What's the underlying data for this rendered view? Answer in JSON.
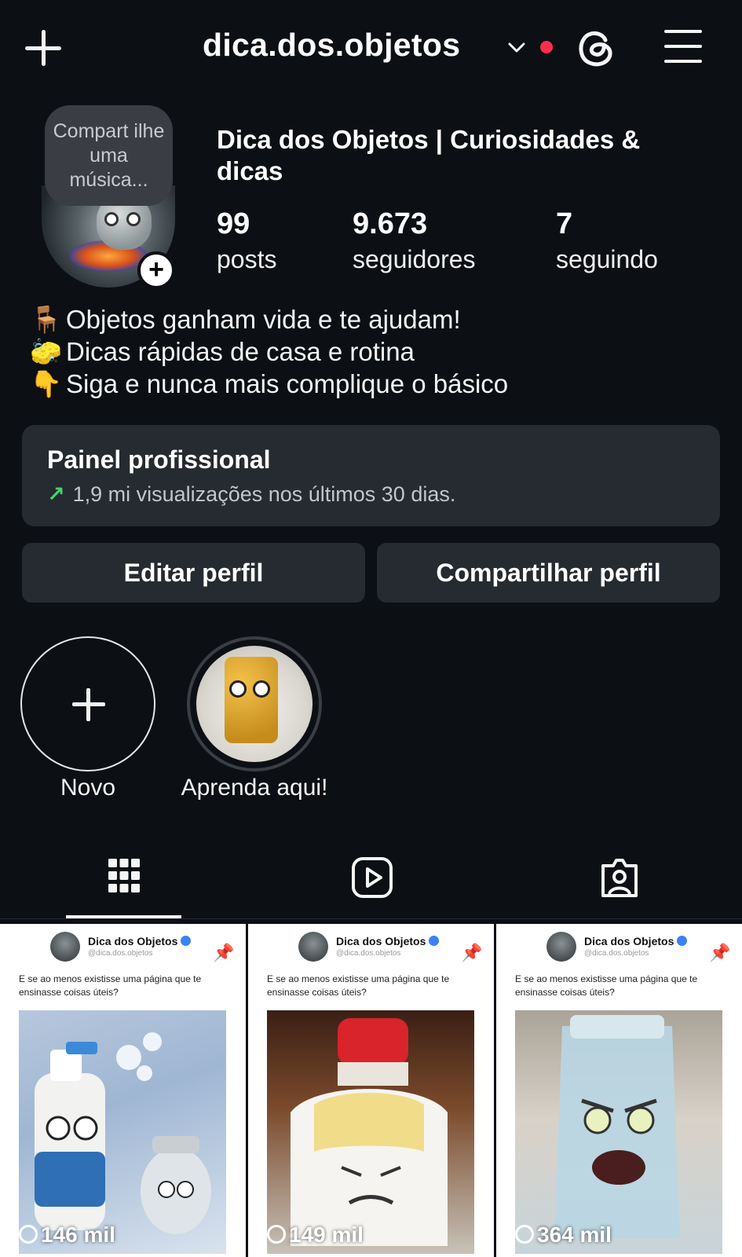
{
  "header": {
    "username": "dica.dos.objetos"
  },
  "profile": {
    "note": "Compart ilhe uma música...",
    "display_name": "Dica dos Objetos | Curiosidades & dicas",
    "stats": [
      {
        "value": "99",
        "label": "posts"
      },
      {
        "value": "9.673",
        "label": "seguidores"
      },
      {
        "value": "7",
        "label": "seguindo"
      }
    ],
    "bio": [
      {
        "emoji": "🪑",
        "text": "Objetos ganham vida e te ajudam!"
      },
      {
        "emoji": "🧽",
        "text": "Dicas rápidas de casa e rotina"
      },
      {
        "emoji": "👇",
        "text": "Siga e nunca mais complique o básico"
      }
    ]
  },
  "dashboard": {
    "title": "Painel profissional",
    "subtitle": "1,9 mi visualizações nos últimos 30 dias."
  },
  "actions": {
    "edit": "Editar perfil",
    "share": "Compartilhar perfil"
  },
  "highlights": [
    {
      "label": "Novo"
    },
    {
      "label": "Aprenda aqui!"
    }
  ],
  "tabs": [
    "grid-icon",
    "reels-icon",
    "tagged-icon"
  ],
  "posts": [
    {
      "name": "Dica dos Objetos",
      "handle": "@dica.dos.objetos",
      "caption": "E se ao menos existisse uma página que te ensinasse coisas úteis?",
      "views": "146 mil"
    },
    {
      "name": "Dica dos Objetos",
      "handle": "@dica.dos.objetos",
      "caption": "E se ao menos existisse uma página que te ensinasse coisas úteis?",
      "views": "149 mil"
    },
    {
      "name": "Dica dos Objetos",
      "handle": "@dica.dos.objetos",
      "caption": "E se ao menos existisse uma página que te ensinasse coisas úteis?",
      "views": "364 mil"
    }
  ],
  "colors": {
    "background": "#0c0f14",
    "card": "#262a31",
    "notification_dot": "#ff2d4b",
    "trend_up": "#46d36a",
    "verified": "#3b82f6"
  }
}
